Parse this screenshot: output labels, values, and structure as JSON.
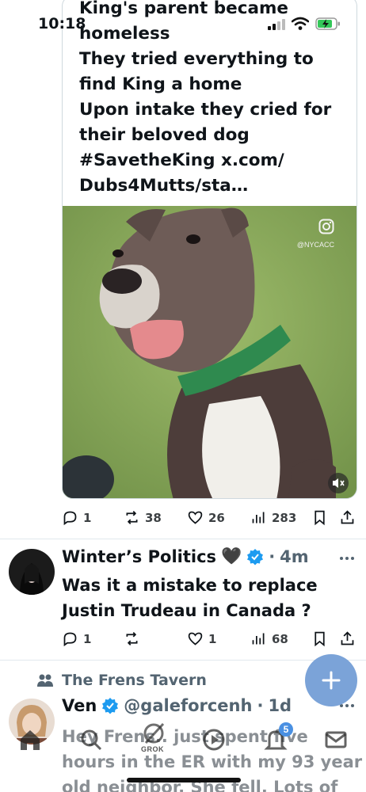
{
  "status_bar": {
    "time": "10:18",
    "signal_icon": "cellular-signal-icon",
    "wifi_icon": "wifi-icon",
    "battery_icon": "battery-charging-icon",
    "battery_color": "#34c759"
  },
  "quoted_post": {
    "text": "King's parent became\nhomeless\nThey tried everything to\nfind King a home\nUpon intake they cried for\ntheir beloved dog\n#SavetheKing x.com/\nDubs4Mutts/sta…",
    "media_watermark": "@NYCACC",
    "media_icon": "instagram-icon",
    "mute_icon": "speaker-muted-icon"
  },
  "post1_actions": {
    "replies": "1",
    "reposts": "38",
    "likes": "26",
    "views": "283"
  },
  "post2": {
    "author": "Winter’s Politics",
    "emoji": "🖤",
    "verified": true,
    "time": "4m",
    "text": "Was it a mistake to replace\nJustin Trudeau in Canada ?",
    "actions": {
      "replies": "1",
      "reposts": "",
      "likes": "1",
      "views": "68"
    }
  },
  "post3": {
    "social_context": "The Frens Tavern",
    "author": "Ven",
    "verified": true,
    "handle": "@galeforcenh",
    "time": "1d",
    "text": "Hey Frens.. just spent five\nhours in the ER with my 93 year\nold neighbor. She fell. Lots of"
  },
  "fab": {
    "icon": "plus-icon"
  },
  "bottom_nav": {
    "items": [
      "home-icon",
      "search-icon",
      "grok-icon",
      "video-icon",
      "notifications-icon",
      "messages-icon"
    ],
    "grok_label": "GROK",
    "notifications_badge": "5"
  },
  "colors": {
    "accent": "#1d9bf0",
    "fab": "#7ba3d8",
    "verified": "#1d9bf0"
  }
}
